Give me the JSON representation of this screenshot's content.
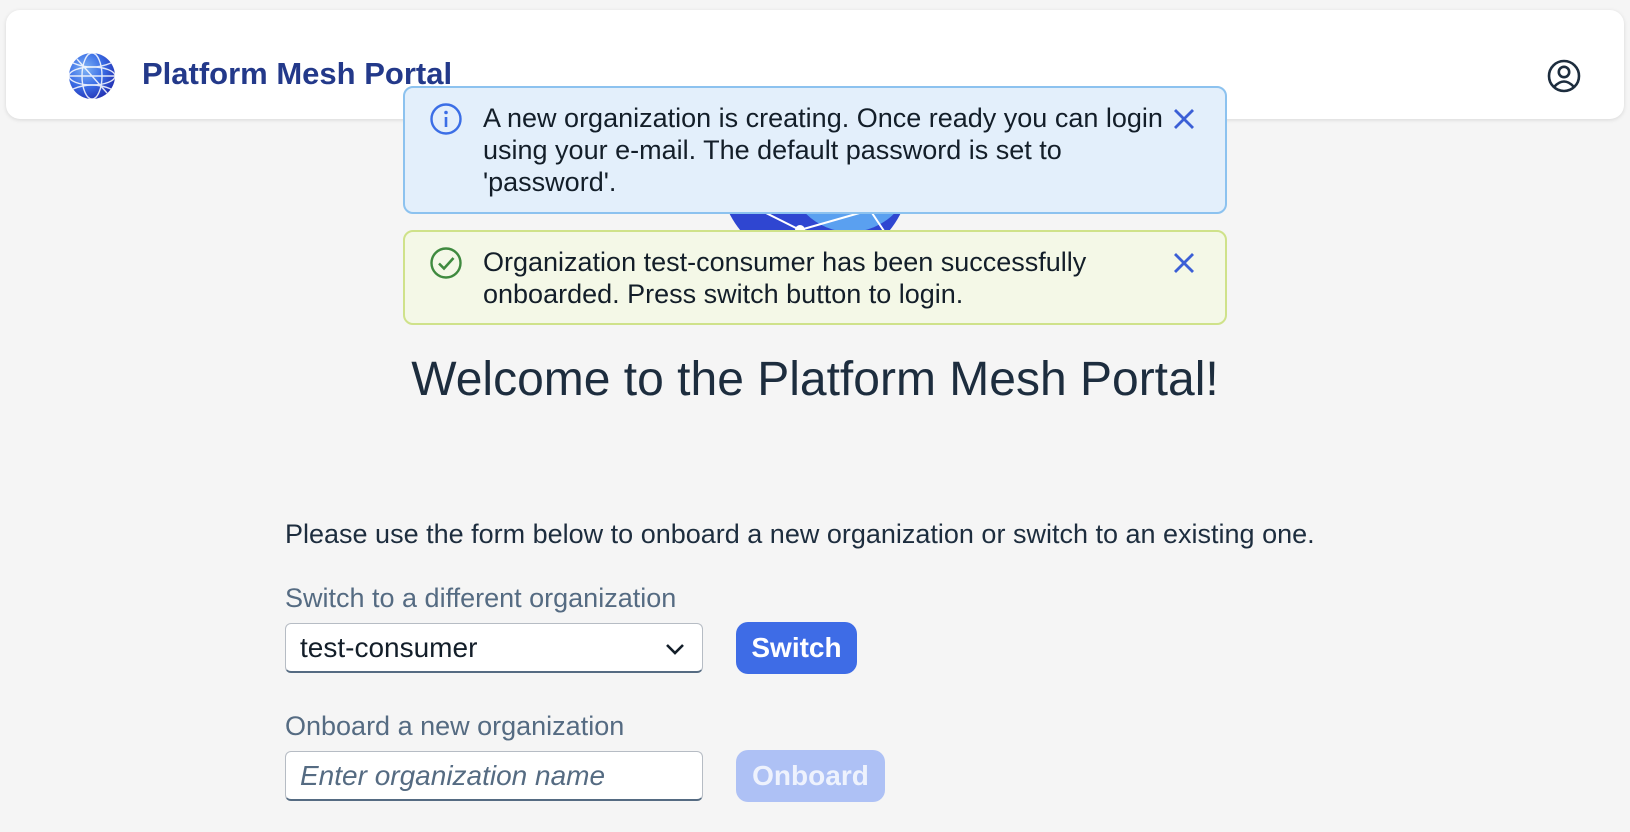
{
  "header": {
    "title": "Platform Mesh Portal",
    "logo_icon": "globe-logo-icon",
    "user_icon": "user-circle-icon"
  },
  "messages": [
    {
      "type": "information",
      "icon": "info-icon",
      "text": "A new organization is creating. Once ready you can login using your e-mail. The default password is set to 'password'."
    },
    {
      "type": "success",
      "icon": "check-circle-icon",
      "text": "Organization test-consumer has been successfully onboarded. Press switch button to login."
    }
  ],
  "main": {
    "welcome": "Welcome to the Platform Mesh Portal!",
    "intro": "Please use the form below to onboard a new organization or switch to an existing one.",
    "switch": {
      "label": "Switch to a different organization",
      "selected": "test-consumer",
      "button": "Switch"
    },
    "onboard": {
      "label": "Onboard a new organization",
      "placeholder": "Enter organization name",
      "value": "",
      "button": "Onboard"
    }
  },
  "colors": {
    "brand": "#23398a",
    "accent": "#3e6ce6",
    "info_bg": "#e3effb",
    "success_bg": "#f4f8e7"
  }
}
